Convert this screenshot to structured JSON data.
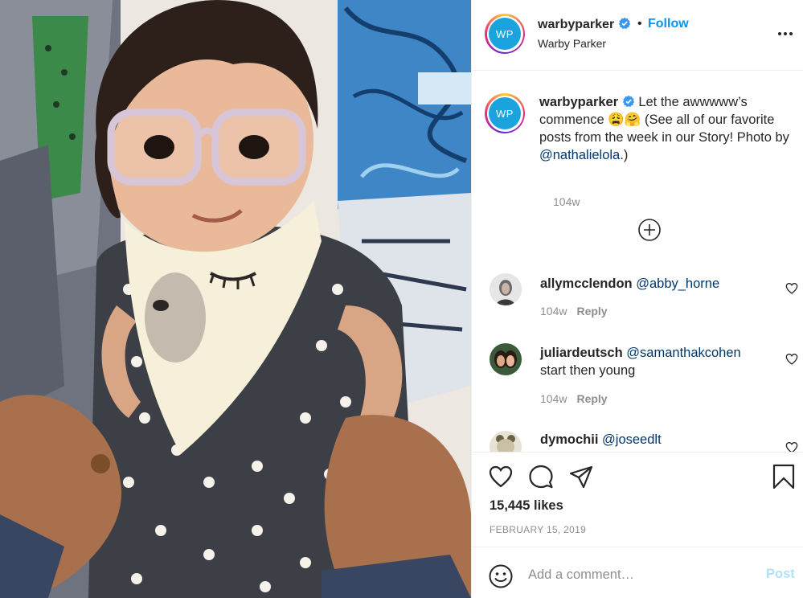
{
  "post": {
    "photo_description": "photo-baby-with-glasses",
    "account": {
      "username": "warbyparker",
      "full_name": "Warby Parker",
      "avatar_initials": "WP",
      "follow_label": "Follow",
      "separator": "•",
      "verified": true
    },
    "caption": {
      "username": "warbyparker",
      "text_part1": "Let the awwwww’s commence 😩🤗 (See all of our favorite posts from the week in our Story! Photo by ",
      "mention": "@nathalielola",
      "text_part2": ".)",
      "time": "104w"
    },
    "comments": [
      {
        "username": "allymcclendon",
        "mention": "@abby_horne",
        "text": "",
        "time": "104w",
        "reply_label": "Reply"
      },
      {
        "username": "juliardeutsch",
        "mention": "@samanthakcohen",
        "text": "start then young",
        "time": "104w",
        "reply_label": "Reply"
      },
      {
        "username": "dymochii",
        "mention": "@joseedlt",
        "text": "",
        "time": "",
        "reply_label": ""
      }
    ],
    "likes": "15,445 likes",
    "date": "FEBRUARY 15, 2019",
    "add_comment": {
      "placeholder": "Add a comment…",
      "post_label": "Post"
    }
  },
  "icons": [
    "more-options-icon",
    "verified-badge-icon",
    "load-more-comments-icon",
    "heart-icon",
    "comment-icon",
    "share-icon",
    "bookmark-icon",
    "emoji-icon"
  ],
  "colors": {
    "link_blue": "#0095f6",
    "mention_blue": "#00376b",
    "muted": "#8e8e8e",
    "post_disabled": "#b2dffc",
    "avatar_blue": "#1aa3dc"
  }
}
